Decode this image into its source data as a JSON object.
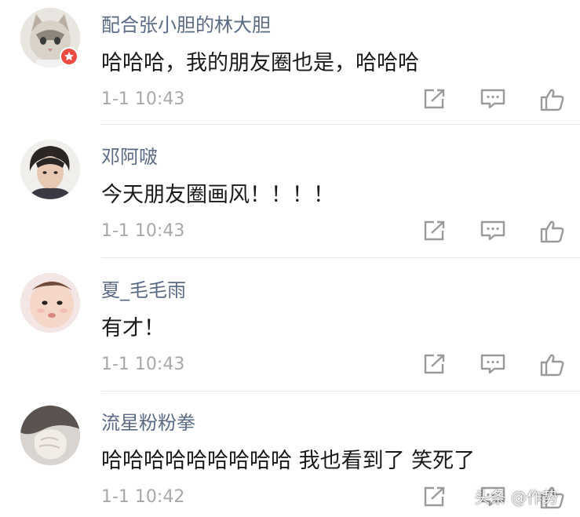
{
  "comments": [
    {
      "username": "配合张小胆的林大胆",
      "text": "哈哈哈，我的朋友圈也是，哈哈哈",
      "time": "1-1 10:43",
      "avatar": "cat-avatar",
      "verified_badge": true
    },
    {
      "username": "邓阿啵",
      "text": "今天朋友圈画风！！！！",
      "time": "1-1 10:43",
      "avatar": "young-man-avatar",
      "verified_badge": false
    },
    {
      "username": "夏_毛毛雨",
      "text": "有才！",
      "time": "1-1 10:43",
      "avatar": "baby-avatar",
      "verified_badge": false
    },
    {
      "username": "流星粉粉拳",
      "text": "哈哈哈哈哈哈哈哈哈 我也看到了 笑死了",
      "time": "1-1 10:42",
      "avatar": "hand-avatar",
      "verified_badge": false
    }
  ],
  "actions": [
    "share-icon",
    "reply-icon",
    "like-icon"
  ],
  "watermark": "头条 @作势",
  "colors": {
    "username": "#5b6b86",
    "text": "#1a1a1a",
    "time": "#a8a8a8",
    "icon": "#9a9a9a",
    "badge": "#ef4b3f"
  }
}
